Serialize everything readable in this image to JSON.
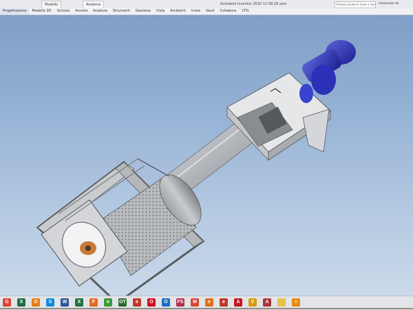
{
  "window": {
    "title": "Autodesk Inventor 2020  11:58:18 sam",
    "tabs": [
      "Modello",
      "Assiema"
    ],
    "search_placeholder": "Ricerca Guida in linea e comandi",
    "user": "emanuele de"
  },
  "ribbon": {
    "tabs": [
      "Progettazione",
      "Modello 3D",
      "Schizzo",
      "Annota",
      "Analizza",
      "Strumenti",
      "Gestione",
      "Vista",
      "Ambienti",
      "Inizia",
      "Vault",
      "Collabora",
      "CFG"
    ]
  },
  "taskbar": {
    "icons": [
      {
        "name": "chrome-icon",
        "glyph": "G",
        "color": "#db4437"
      },
      {
        "name": "excel-icon",
        "glyph": "X",
        "color": "#1e7145"
      },
      {
        "name": "outlook-icon",
        "glyph": "O",
        "color": "#e67c16"
      },
      {
        "name": "skype-icon",
        "glyph": "S",
        "color": "#0a8ddc"
      },
      {
        "name": "word-icon",
        "glyph": "W",
        "color": "#2b579a"
      },
      {
        "name": "excel-2-icon",
        "glyph": "X",
        "color": "#217346"
      },
      {
        "name": "firefox-icon",
        "glyph": "F",
        "color": "#e76a1e"
      },
      {
        "name": "app-green-icon",
        "glyph": "e",
        "color": "#3a9a3a"
      },
      {
        "name": "ot-icon",
        "glyph": "OT",
        "color": "#2a6a2a"
      },
      {
        "name": "app-red-icon",
        "glyph": "e",
        "color": "#c0392b"
      },
      {
        "name": "opera-icon",
        "glyph": "O",
        "color": "#cc1020"
      },
      {
        "name": "outlook-2-icon",
        "glyph": "O",
        "color": "#1c6ec4"
      },
      {
        "name": "fs-icon",
        "glyph": "FS",
        "color": "#b03050"
      },
      {
        "name": "gmail-icon",
        "glyph": "M",
        "color": "#d44638"
      },
      {
        "name": "app-orange-icon",
        "glyph": "e",
        "color": "#e0701a"
      },
      {
        "name": "app-red-2-icon",
        "glyph": "e",
        "color": "#c0392b"
      },
      {
        "name": "acrobat-icon",
        "glyph": "A",
        "color": "#c4161c"
      },
      {
        "name": "vault-icon",
        "glyph": "V",
        "color": "#d79b12"
      },
      {
        "name": "access-icon",
        "glyph": "A",
        "color": "#a4373a"
      },
      {
        "name": "folder-icon",
        "glyph": "",
        "color": "#e8c14a"
      },
      {
        "name": "inventor-icon",
        "glyph": "I",
        "color": "#e88a10"
      }
    ]
  }
}
